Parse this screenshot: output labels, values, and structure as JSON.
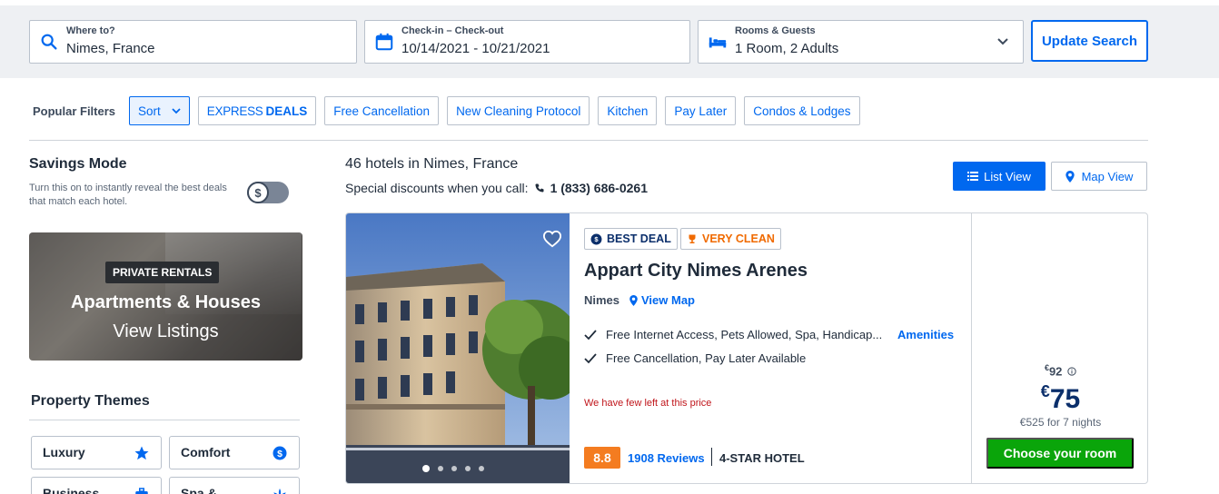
{
  "search": {
    "where_label": "Where to?",
    "where_value": "Nimes, France",
    "dates_label": "Check-in – Check-out",
    "dates_value": "10/14/2021 - 10/21/2021",
    "rooms_label": "Rooms & Guests",
    "rooms_value": "1 Room, 2 Adults",
    "update_label": "Update Search"
  },
  "filters": {
    "title": "Popular Filters",
    "sort_label": "Sort",
    "express_thin": "EXPRESS",
    "express_bold": "DEALS",
    "chips": [
      "Free Cancellation",
      "New Cleaning Protocol",
      "Kitchen",
      "Pay Later",
      "Condos & Lodges"
    ]
  },
  "savings": {
    "title": "Savings Mode",
    "desc": "Turn this on to instantly reveal the best deals that match each hotel.",
    "toggle_symbol": "$"
  },
  "rentals": {
    "badge": "PRIVATE RENTALS",
    "title": "Apartments & Houses",
    "cta": "View Listings"
  },
  "themes": {
    "title": "Property Themes",
    "items": [
      "Luxury",
      "Comfort",
      "Business",
      "Spa &"
    ]
  },
  "results": {
    "count_text": "46 hotels in Nimes, France",
    "phone_prefix": "Special discounts when you call:",
    "phone_number": "1 (833) 686-0261",
    "list_view": "List View",
    "map_view": "Map View"
  },
  "hotel": {
    "badge_best": "BEST DEAL",
    "badge_clean": "VERY CLEAN",
    "name": "Appart City Nimes Arenes",
    "city": "Nimes",
    "view_map": "View Map",
    "amenities": "Free Internet Access, Pets Allowed, Spa, Handicap...",
    "amenities_link": "Amenities",
    "policies": "Free Cancellation, Pay Later Available",
    "scarcity": "We have few left at this price",
    "rating": "8.8",
    "reviews": "1908 Reviews",
    "stars": "4-STAR HOTEL",
    "currency": "€",
    "old_price": "92",
    "price": "75",
    "total": "€525 for 7 nights",
    "cta": "Choose your room"
  },
  "colors": {
    "brand_blue": "#0068ef",
    "navy": "#0b2f6b",
    "cta_green": "#0aa50a",
    "rating_orange": "#f47c20",
    "scarcity_red": "#c0151b"
  }
}
